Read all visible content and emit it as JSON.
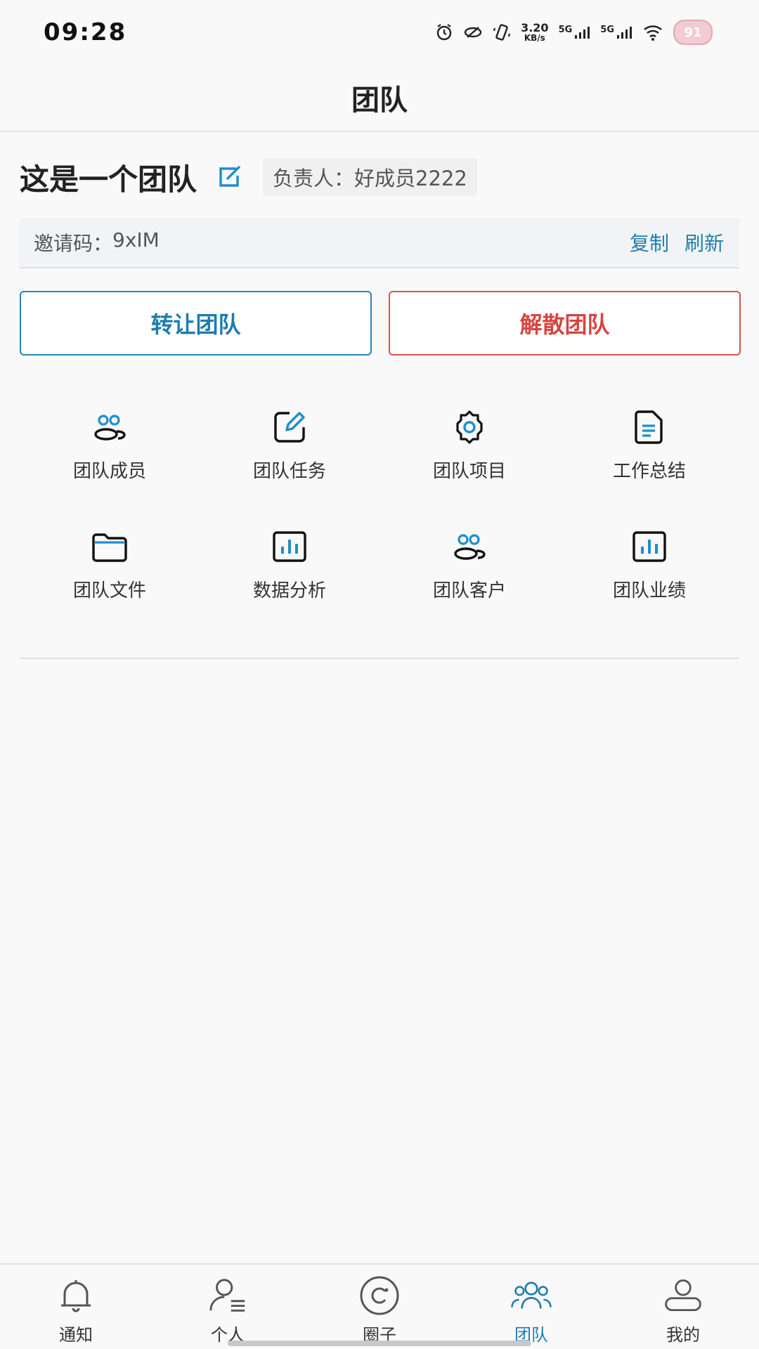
{
  "status_bar": {
    "time": "09:28",
    "speed_value": "3.20",
    "speed_unit": "KB/s",
    "sim1_label": "5G",
    "sim2_label": "5G",
    "battery": "91",
    "icons": [
      "alarm-icon",
      "link-icon",
      "vibrate-icon",
      "signal-icon",
      "signal-icon",
      "wifi-icon",
      "battery-icon"
    ]
  },
  "header": {
    "title": "团队"
  },
  "team": {
    "name": "这是一个团队",
    "leader_label": "负责人：",
    "leader_name": "好成员2222"
  },
  "invite": {
    "label": "邀请码：",
    "code": "9xIM",
    "copy": "复制",
    "refresh": "刷新"
  },
  "actions": {
    "transfer": "转让团队",
    "dissolve": "解散团队"
  },
  "grid": [
    {
      "label": "团队成员",
      "icon": "members-icon"
    },
    {
      "label": "团队任务",
      "icon": "edit-task-icon"
    },
    {
      "label": "团队项目",
      "icon": "settings-gear-icon"
    },
    {
      "label": "工作总结",
      "icon": "document-icon"
    },
    {
      "label": "团队文件",
      "icon": "folder-icon"
    },
    {
      "label": "数据分析",
      "icon": "bar-chart-icon"
    },
    {
      "label": "团队客户",
      "icon": "customers-icon"
    },
    {
      "label": "团队业绩",
      "icon": "performance-chart-icon"
    }
  ],
  "colors": {
    "accent": "#1e7bae",
    "danger": "#d64541"
  },
  "tabs": [
    {
      "label": "通知",
      "icon": "bell-icon",
      "active": false
    },
    {
      "label": "个人",
      "icon": "person-list-icon",
      "active": false
    },
    {
      "label": "圈子",
      "icon": "circle-icon",
      "active": false
    },
    {
      "label": "团队",
      "icon": "team-icon",
      "active": true
    },
    {
      "label": "我的",
      "icon": "profile-icon",
      "active": false
    }
  ]
}
